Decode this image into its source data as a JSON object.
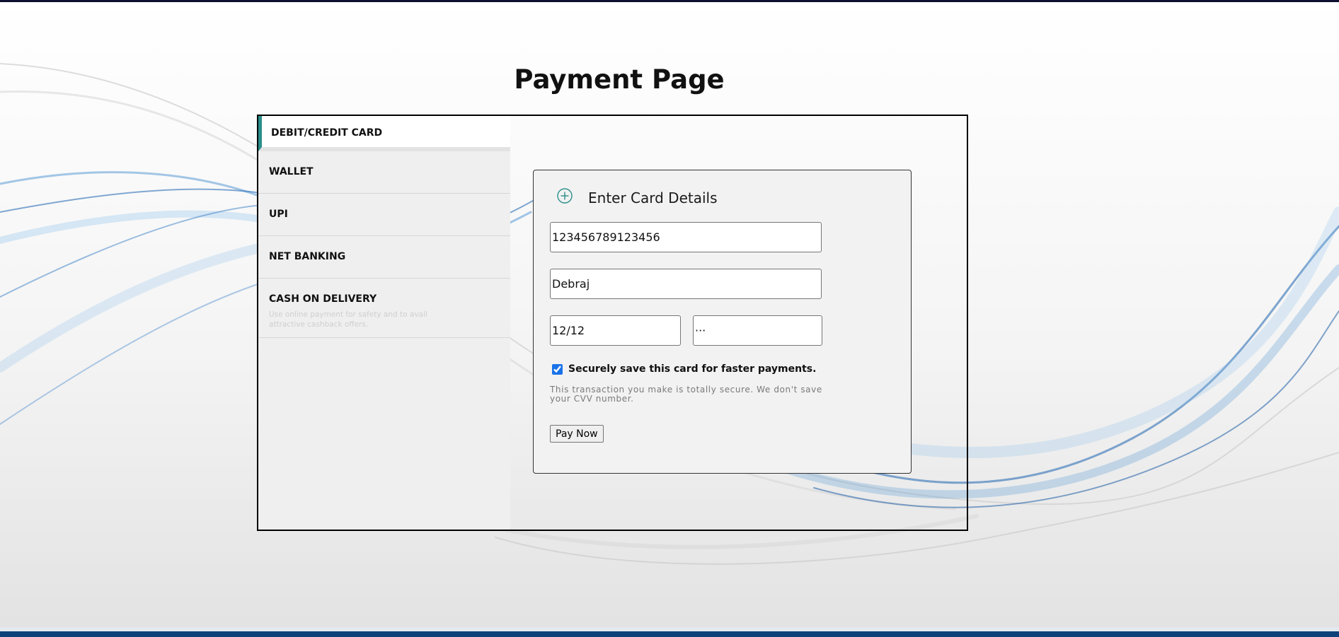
{
  "page": {
    "title": "Payment Page"
  },
  "tabs": [
    {
      "label": "DEBIT/CREDIT CARD",
      "active": true
    },
    {
      "label": "WALLET"
    },
    {
      "label": "UPI"
    },
    {
      "label": "NET BANKING"
    },
    {
      "label": "CASH ON DELIVERY",
      "subtext": "Use online payment for safety and to avail attractive cashback offers."
    }
  ],
  "card_form": {
    "heading": "Enter Card Details",
    "icon": "plus-circle-icon",
    "card_number": "123456789123456",
    "name": "Debraj",
    "expiry": "12/12",
    "cvv": "···",
    "save_label": "Securely save this card for faster payments.",
    "save_checked": true,
    "secure_note": "This transaction you make is totally secure. We don't save your CVV number.",
    "pay_button": "Pay Now"
  },
  "colors": {
    "accent": "#2b8f8b",
    "top_bar": "#0d1030",
    "bottom_bar": "#0e4179",
    "checkbox": "#1a73e8"
  }
}
